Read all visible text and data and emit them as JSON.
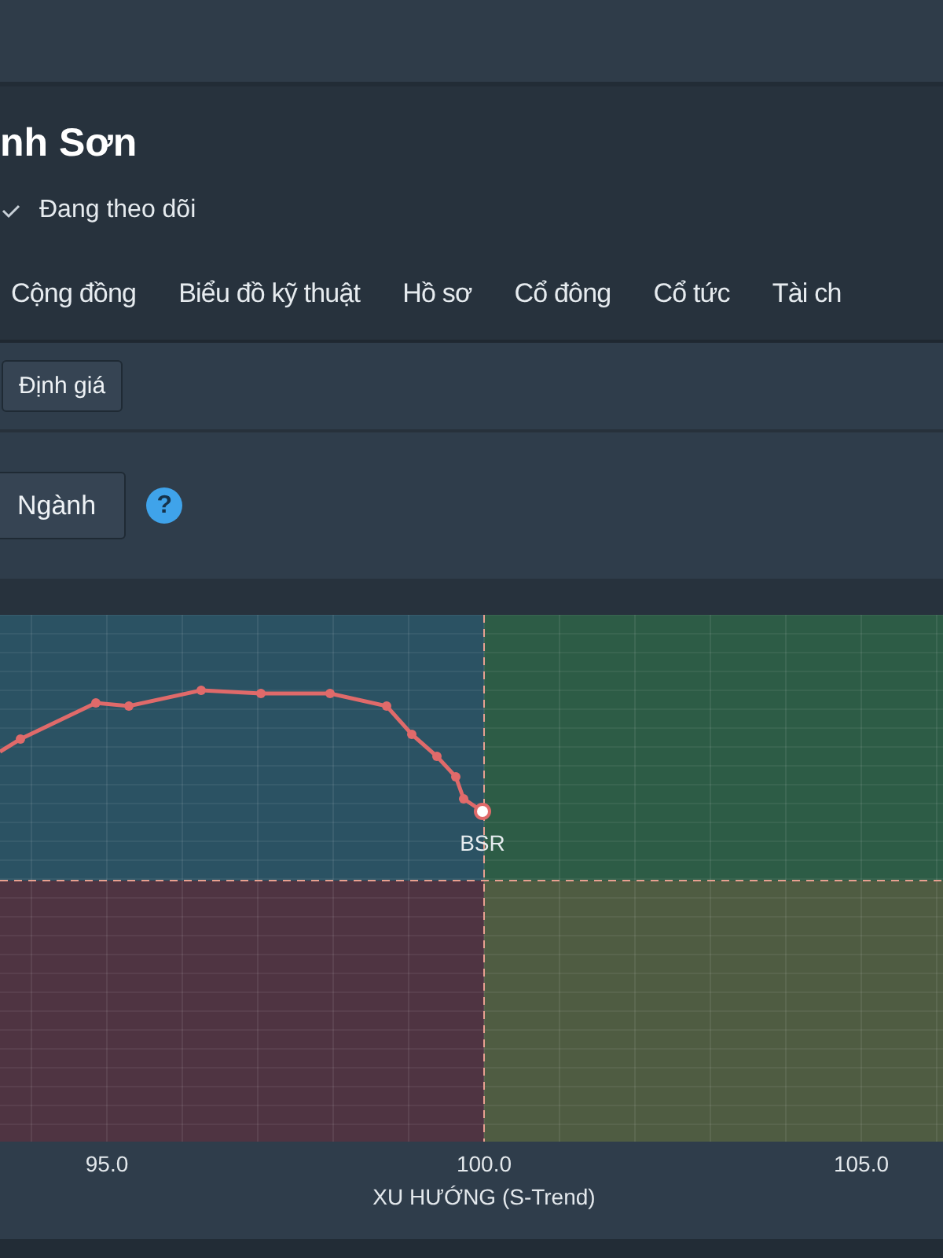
{
  "header": {
    "title": "nh Sơn",
    "follow_label": "Đang theo dõi",
    "following": true
  },
  "tabs": [
    {
      "label": "Cộng đồng"
    },
    {
      "label": "Biểu đồ kỹ thuật"
    },
    {
      "label": "Hồ sơ"
    },
    {
      "label": "Cổ đông"
    },
    {
      "label": "Cổ tức"
    },
    {
      "label": "Tài ch"
    }
  ],
  "toolbar": {
    "button": "Định giá"
  },
  "filter": {
    "button": "Ngành",
    "help": "?"
  },
  "chart": {
    "point_label": "BSR",
    "x_ticks": [
      "95.0",
      "100.0",
      "105.0"
    ],
    "x_title": "XU HƯỚNG (S-Trend)"
  }
}
